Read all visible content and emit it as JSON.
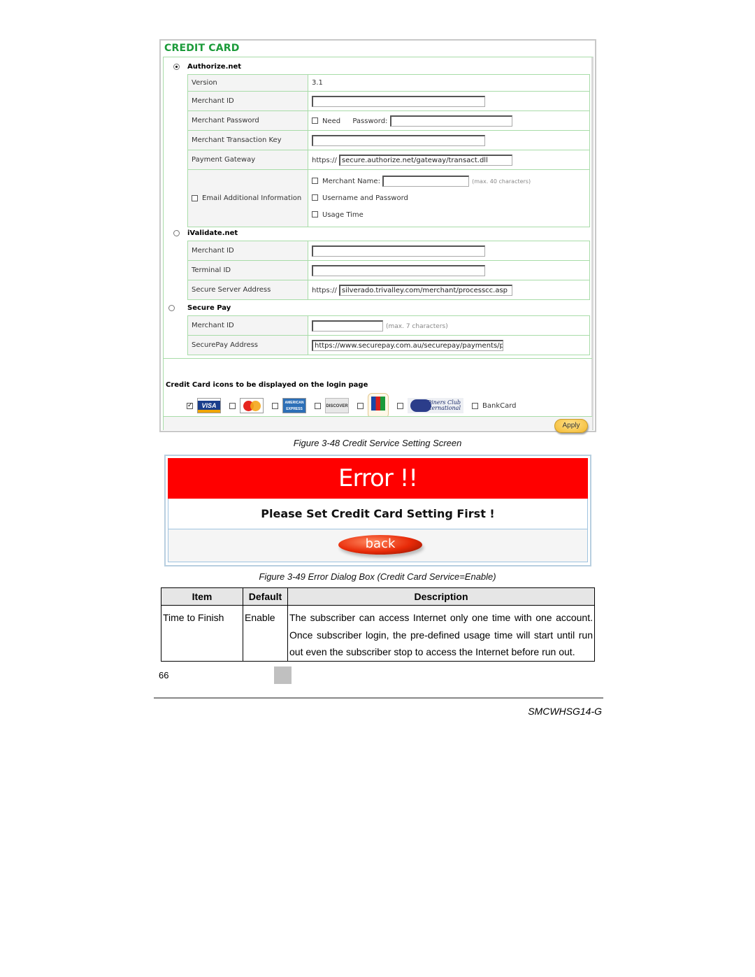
{
  "credit_card": {
    "title": "CREDIT CARD",
    "authorize": {
      "label": "Authorize.net",
      "selected": true,
      "version_label": "Version",
      "version_value": "3.1",
      "merchant_id_label": "Merchant ID",
      "merchant_id_value": "",
      "merchant_password_label": "Merchant Password",
      "need_label": "Need",
      "password_label": "Password:",
      "password_value": "",
      "transaction_key_label": "Merchant Transaction Key",
      "transaction_key_value": "",
      "gateway_label": "Payment Gateway",
      "gateway_prefix": "https://",
      "gateway_value": "secure.authorize.net/gateway/transact.dll",
      "email_label": "Email Additional Information",
      "merchant_name_label": "Merchant Name:",
      "merchant_name_value": "",
      "merchant_name_hint": "(max. 40 characters)",
      "username_password_label": "Username and Password",
      "usage_time_label": "Usage Time"
    },
    "ivalidate": {
      "label": "iValidate.net",
      "selected": false,
      "merchant_id_label": "Merchant ID",
      "merchant_id_value": "",
      "terminal_id_label": "Terminal ID",
      "terminal_id_value": "",
      "server_label": "Secure Server Address",
      "server_prefix": "https://",
      "server_value": "silverado.trivalley.com/merchant/processcc.asp"
    },
    "securepay": {
      "label": "Secure Pay",
      "selected": false,
      "merchant_id_label": "Merchant ID",
      "merchant_id_value": "",
      "merchant_id_hint": "(max. 7 characters)",
      "address_label": "SecurePay Address",
      "address_value": "https://www.securepay.com.au/securepay/payments/proc"
    },
    "icons_title": "Credit Card icons to be displayed on the login page",
    "cards": [
      {
        "name": "VISA",
        "checked": true
      },
      {
        "name": "MasterCard",
        "checked": false
      },
      {
        "name": "American Express",
        "checked": false
      },
      {
        "name": "Discover",
        "checked": false
      },
      {
        "name": "JCB",
        "checked": false
      },
      {
        "name": "Diners Club International",
        "checked": false
      },
      {
        "name": "BankCard",
        "checked": false
      }
    ],
    "card_text": {
      "visa": "VISA",
      "mc": "",
      "amex": "AMERICAN EXPRESS",
      "discover": "DISCOVER",
      "jcb": "",
      "diners": "Diners Club International",
      "bankcard": "BankCard"
    },
    "apply_label": "Apply"
  },
  "caption1": "Figure 3-48 Credit Service Setting Screen",
  "error_dialog": {
    "title": "Error !!",
    "message": "Please Set Credit Card Setting First !",
    "back_label": "back",
    "header_color": "#ff0000"
  },
  "caption2": "Figure 3-49 Error Dialog Box (Credit Card Service=Enable)",
  "spec_table": {
    "headers": [
      "Item",
      "Default",
      "Description"
    ],
    "rows": [
      {
        "item": "Time to Finish",
        "default": "Enable",
        "description": "The subscriber can access Internet only one time with one account. Once subscriber login, the pre-defined usage time will start until run out even the subscriber stop to access the Internet before run out."
      }
    ]
  },
  "footer": {
    "page_number": "66",
    "model": "SMCWHSG14-G"
  }
}
